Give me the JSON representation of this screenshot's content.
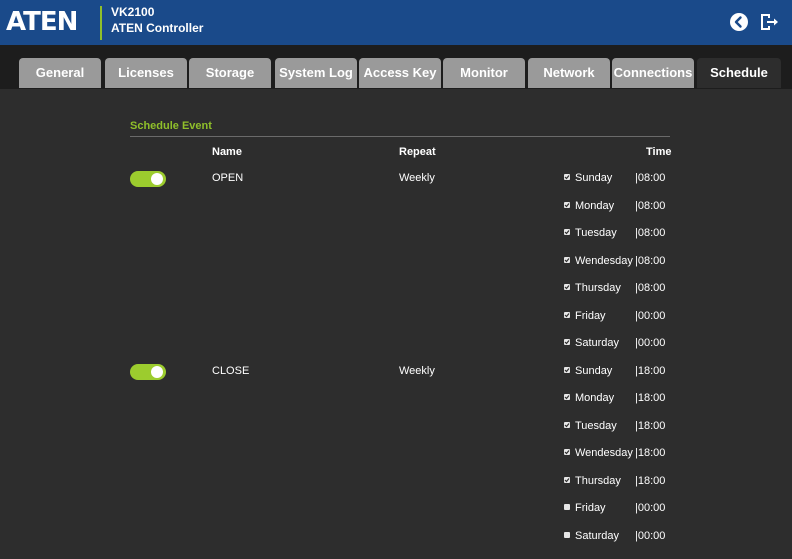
{
  "app": {
    "logo": "ATEN",
    "model": "VK2100",
    "name": "ATEN Controller"
  },
  "header_icons": [
    "back-circle-icon",
    "logout-icon"
  ],
  "tabs": [
    "General",
    "Licenses",
    "Storage",
    "System Log",
    "Access Key",
    "Monitor",
    "Network",
    "Connections",
    "Schedule"
  ],
  "active_tab": "Schedule",
  "schedule": {
    "section_title": "Schedule Event",
    "columns": {
      "name": "Name",
      "repeat": "Repeat",
      "time": "Time"
    },
    "events": [
      {
        "enabled": true,
        "name": "OPEN",
        "repeat": "Weekly",
        "days": [
          {
            "day": "Sunday",
            "checked": true,
            "time": "|08:00"
          },
          {
            "day": "Monday",
            "checked": true,
            "time": "|08:00"
          },
          {
            "day": "Tuesday",
            "checked": true,
            "time": "|08:00"
          },
          {
            "day": "Wendesday",
            "checked": true,
            "time": "|08:00"
          },
          {
            "day": "Thursday",
            "checked": true,
            "time": "|08:00"
          },
          {
            "day": "Friday",
            "checked": true,
            "time": "|00:00"
          },
          {
            "day": "Saturday",
            "checked": true,
            "time": "|00:00"
          }
        ]
      },
      {
        "enabled": true,
        "name": "CLOSE",
        "repeat": "Weekly",
        "days": [
          {
            "day": "Sunday",
            "checked": true,
            "time": "|18:00"
          },
          {
            "day": "Monday",
            "checked": true,
            "time": "|18:00"
          },
          {
            "day": "Tuesday",
            "checked": true,
            "time": "|18:00"
          },
          {
            "day": "Wendesday",
            "checked": true,
            "time": "|18:00"
          },
          {
            "day": "Thursday",
            "checked": true,
            "time": "|18:00"
          },
          {
            "day": "Friday",
            "checked": false,
            "time": "|00:00"
          },
          {
            "day": "Saturday",
            "checked": false,
            "time": "|00:00"
          }
        ]
      }
    ]
  },
  "colors": {
    "header_bg": "#1a4a8a",
    "accent": "#8fbf2a",
    "toggle_on": "#9ccc2e",
    "tab_inactive": "#9a9a9a",
    "content_bg": "#2d2d2d"
  }
}
